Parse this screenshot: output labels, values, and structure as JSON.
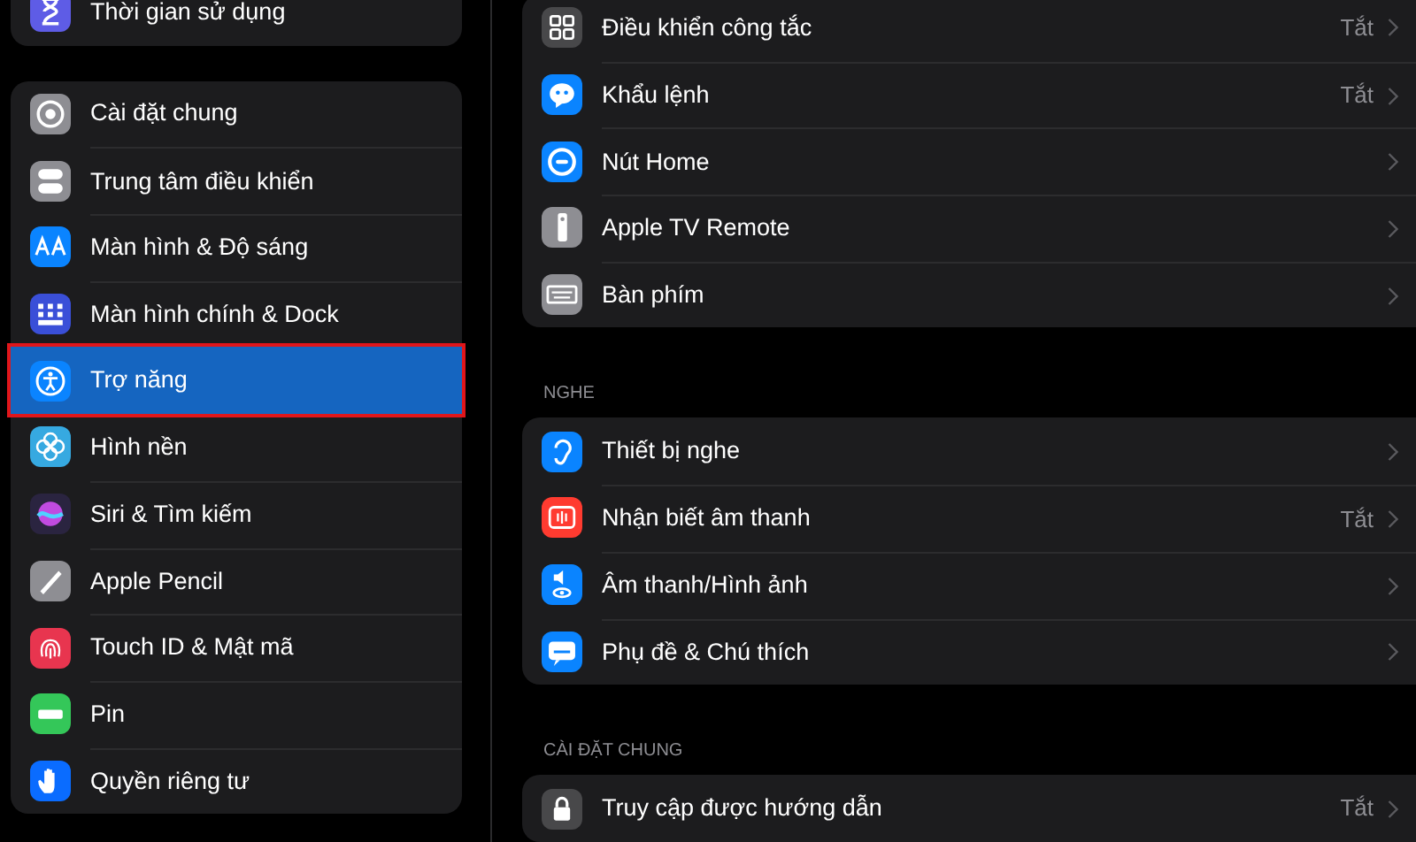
{
  "sidebar": {
    "groups": [
      {
        "items": [
          {
            "label": "Thời gian sử dụng",
            "selected": false
          }
        ]
      },
      {
        "items": [
          {
            "label": "Cài đặt chung",
            "selected": false
          },
          {
            "label": "Trung tâm điều khiển",
            "selected": false
          },
          {
            "label": "Màn hình & Độ sáng",
            "selected": false
          },
          {
            "label": "Màn hình chính & Dock",
            "selected": false
          },
          {
            "label": "Trợ năng",
            "selected": true
          },
          {
            "label": "Hình nền",
            "selected": false
          },
          {
            "label": "Siri & Tìm kiếm",
            "selected": false
          },
          {
            "label": "Apple Pencil",
            "selected": false
          },
          {
            "label": "Touch ID & Mật mã",
            "selected": false
          },
          {
            "label": "Pin",
            "selected": false
          },
          {
            "label": "Quyền riêng tư",
            "selected": false
          }
        ]
      }
    ]
  },
  "detail": {
    "sections": [
      {
        "items": [
          {
            "label": "Điều khiển công tắc",
            "value": "Tắt"
          },
          {
            "label": "Khẩu lệnh",
            "value": "Tắt"
          },
          {
            "label": "Nút Home"
          },
          {
            "label": "Apple TV Remote"
          },
          {
            "label": "Bàn phím"
          }
        ]
      },
      {
        "header": "NGHE",
        "items": [
          {
            "label": "Thiết bị nghe"
          },
          {
            "label": "Nhận biết âm thanh",
            "value": "Tắt"
          },
          {
            "label": "Âm thanh/Hình ảnh"
          },
          {
            "label": "Phụ đề & Chú thích"
          }
        ]
      },
      {
        "header": "CÀI ĐẶT CHUNG",
        "items": [
          {
            "label": "Truy cập được hướng dẫn",
            "value": "Tắt"
          }
        ]
      }
    ]
  }
}
